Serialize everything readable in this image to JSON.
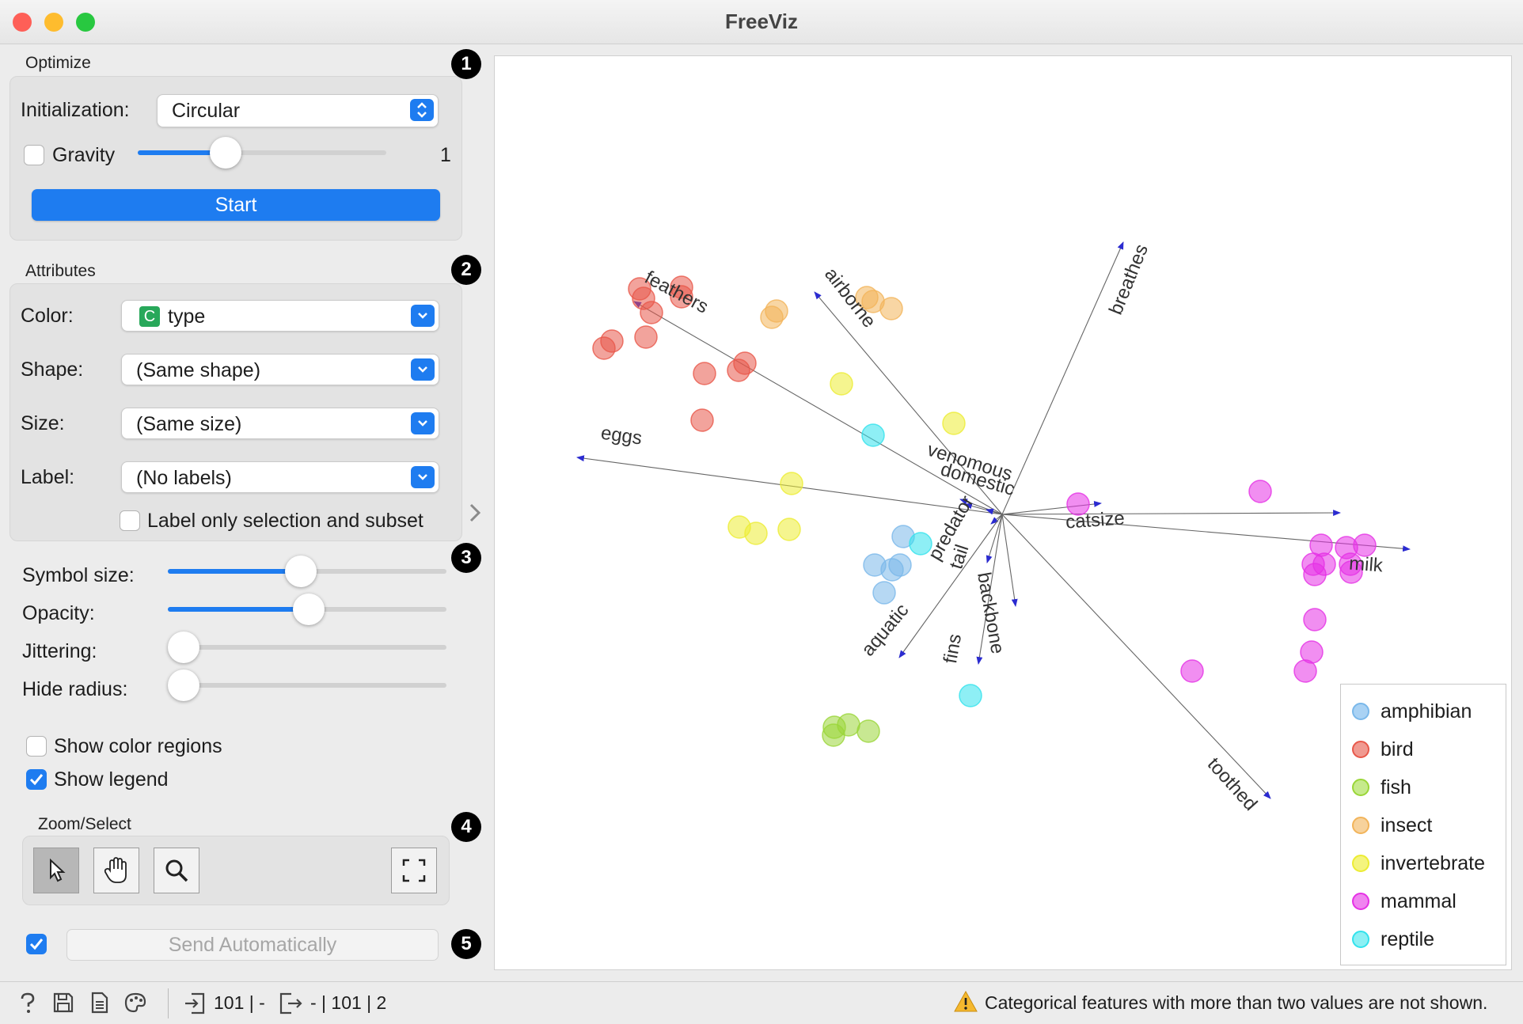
{
  "window": {
    "title": "FreeViz",
    "colors": {
      "close": "#fe5f57",
      "minimize": "#febc2e",
      "maximize": "#28c840",
      "accent": "#1e7cf0"
    }
  },
  "optimize": {
    "group_title": "Optimize",
    "badge": "1",
    "initialization_label": "Initialization:",
    "initialization_value": "Circular",
    "gravity_label": "Gravity",
    "gravity_checked": false,
    "gravity_value": "1",
    "start_label": "Start"
  },
  "attributes": {
    "group_title": "Attributes",
    "badge": "2",
    "color_label": "Color:",
    "color_badge": "C",
    "color_value": "type",
    "shape_label": "Shape:",
    "shape_value": "(Same shape)",
    "size_label": "Size:",
    "size_value": "(Same size)",
    "label_label": "Label:",
    "label_value": "(No labels)",
    "label_only_selection": "Label only selection and subset",
    "label_only_checked": false
  },
  "display": {
    "badge": "3",
    "symbol_size_label": "Symbol size:",
    "symbol_size_level": 0.47,
    "opacity_label": "Opacity:",
    "opacity_level": 0.5,
    "jittering_label": "Jittering:",
    "jittering_level": 0,
    "hide_radius_label": "Hide radius:",
    "hide_radius_level": 0,
    "show_color_regions": "Show color regions",
    "show_color_regions_checked": false,
    "show_legend": "Show legend",
    "show_legend_checked": true
  },
  "zoom_select": {
    "group_title": "Zoom/Select",
    "badge": "4",
    "tools": [
      "select-pointer",
      "pan-hand",
      "zoom-magnifier"
    ],
    "reset_tool": "reset-zoom"
  },
  "commit": {
    "badge": "5",
    "auto_checked": true,
    "send_label": "Send Automatically"
  },
  "plot": {
    "anchors": [
      {
        "name": "feathers"
      },
      {
        "name": "airborne"
      },
      {
        "name": "breathes"
      },
      {
        "name": "eggs"
      },
      {
        "name": "venomous"
      },
      {
        "name": "domestic"
      },
      {
        "name": "predator"
      },
      {
        "name": "tail"
      },
      {
        "name": "aquatic"
      },
      {
        "name": "fins"
      },
      {
        "name": "backbone"
      },
      {
        "name": "catsize"
      },
      {
        "name": "milk"
      },
      {
        "name": "toothed"
      }
    ],
    "legend": [
      {
        "label": "amphibian",
        "color": "#7ab8ea"
      },
      {
        "label": "bird",
        "color": "#e8584a"
      },
      {
        "label": "fish",
        "color": "#9ad638"
      },
      {
        "label": "insect",
        "color": "#f2b45a"
      },
      {
        "label": "invertebrate",
        "color": "#ecec33"
      },
      {
        "label": "mammal",
        "color": "#e531e5"
      },
      {
        "label": "reptile",
        "color": "#32e2ec"
      }
    ]
  },
  "statusbar": {
    "input_summary": "101 | -",
    "output_summary": "- | 101 | 2",
    "warning": "Categorical features with more than two values are not shown."
  }
}
